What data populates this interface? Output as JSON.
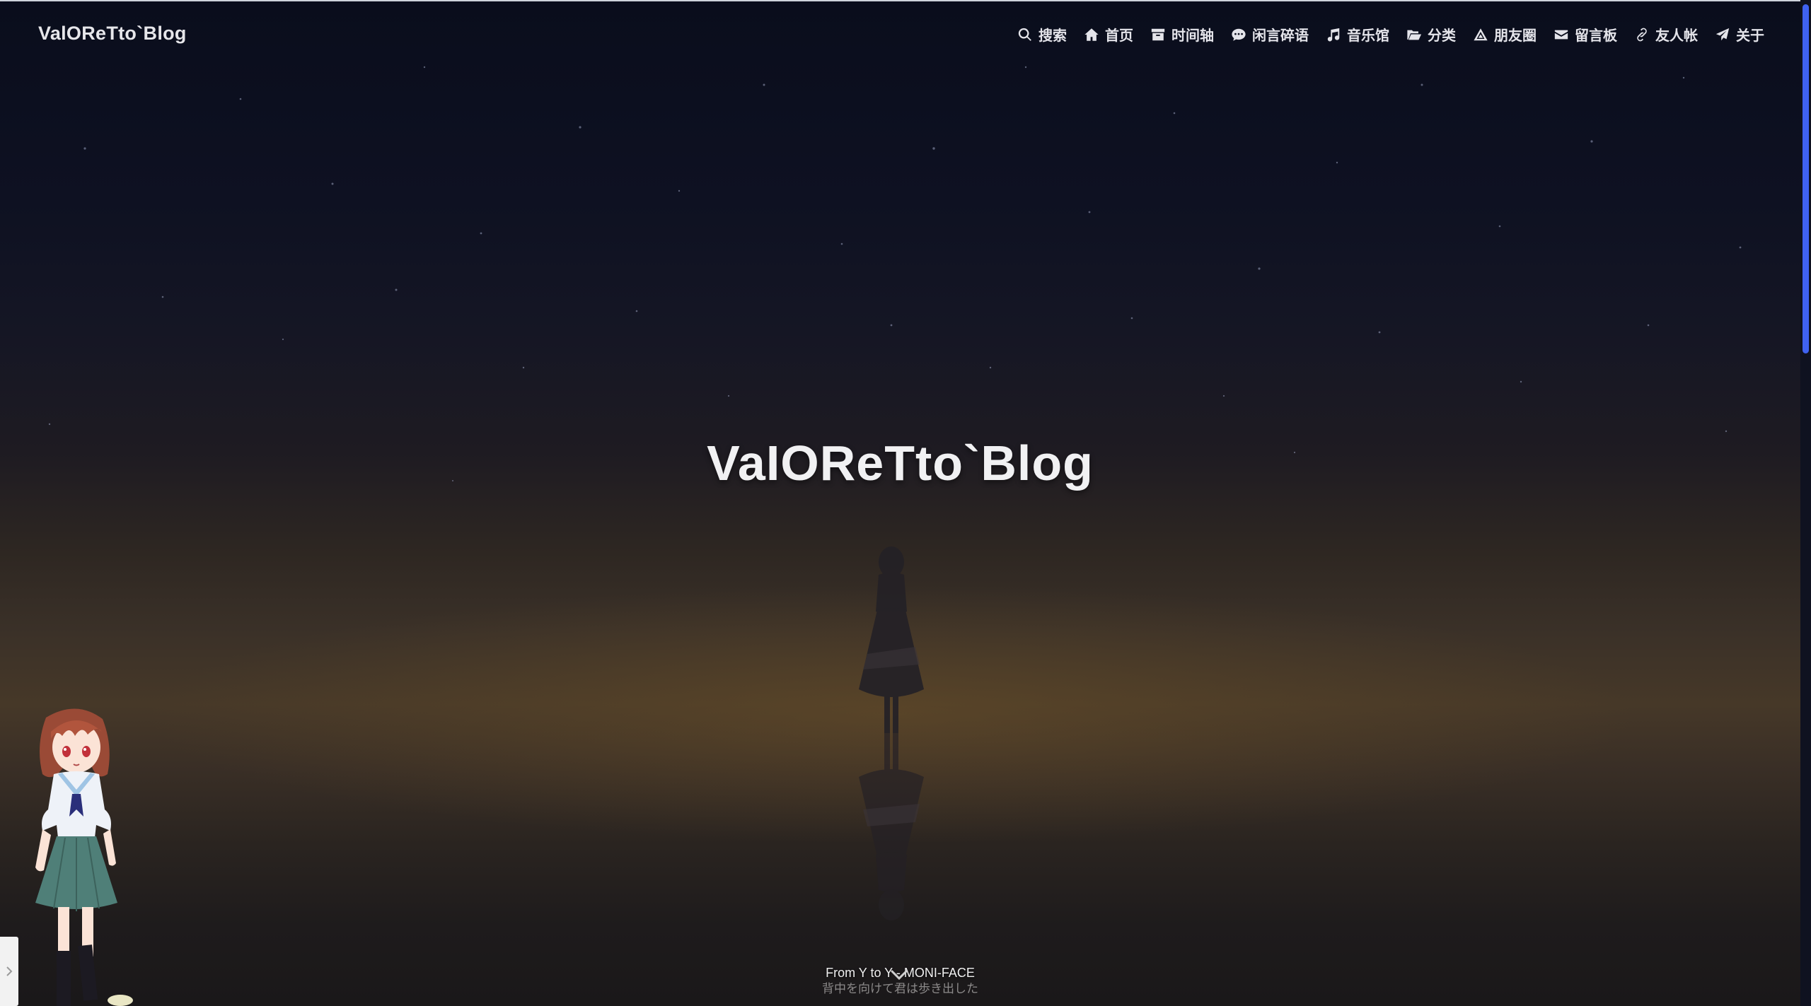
{
  "site": {
    "name": "ValOReTto`Blog"
  },
  "nav": {
    "items": [
      {
        "label": "搜索",
        "icon": "search-icon"
      },
      {
        "label": "首页",
        "icon": "home-icon"
      },
      {
        "label": "时间轴",
        "icon": "archive-icon"
      },
      {
        "label": "闲言碎语",
        "icon": "comment-icon"
      },
      {
        "label": "音乐馆",
        "icon": "music-icon"
      },
      {
        "label": "分类",
        "icon": "folder-open-icon"
      },
      {
        "label": "朋友圈",
        "icon": "triangle-icon"
      },
      {
        "label": "留言板",
        "icon": "envelope-icon"
      },
      {
        "label": "友人帐",
        "icon": "link-icon"
      },
      {
        "label": "关于",
        "icon": "paper-plane-icon"
      }
    ]
  },
  "hero": {
    "title": "VaIOReTto`Blog"
  },
  "music": {
    "line1": "From Y to Y - MONI-FACE",
    "line2": "背中を向けて君は歩き出した"
  },
  "colors": {
    "accent": "#3f62f0",
    "text": "#e4e4ea",
    "sky_top": "#0a0d1c",
    "horizon": "#463828"
  }
}
